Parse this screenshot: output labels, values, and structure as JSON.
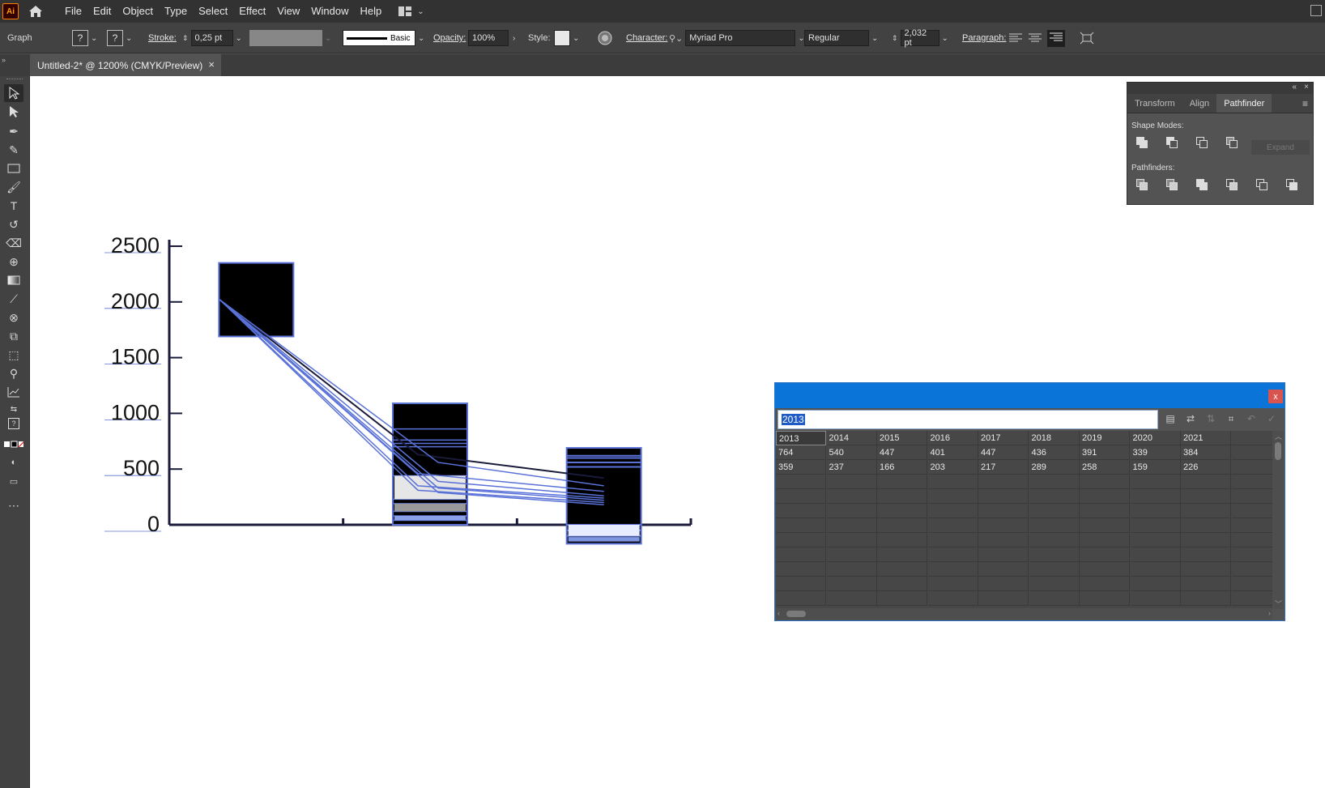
{
  "menubar": {
    "app_logo": "Ai",
    "items": [
      "File",
      "Edit",
      "Object",
      "Type",
      "Select",
      "Effect",
      "View",
      "Window",
      "Help"
    ]
  },
  "controlbar": {
    "selection_type": "Graph",
    "stroke_label": "Stroke:",
    "stroke_value": "0,25 pt",
    "brush_name": "Basic",
    "opacity_label": "Opacity:",
    "opacity_value": "100%",
    "style_label": "Style:",
    "character_label": "Character:",
    "font_family": "Myriad Pro",
    "font_style": "Regular",
    "font_size": "2,032 pt",
    "paragraph_label": "Paragraph:",
    "fill_icon": "?",
    "stroke_icon": "?"
  },
  "document_tab": {
    "title": "Untitled-2* @ 1200% (CMYK/Preview)",
    "close": "×"
  },
  "pathfinder": {
    "tabs": [
      "Transform",
      "Align",
      "Pathfinder"
    ],
    "active_tab": "Pathfinder",
    "shape_modes_label": "Shape Modes:",
    "pathfinders_label": "Pathfinders:",
    "expand_label": "Expand"
  },
  "graph_data": {
    "close_label": "x",
    "input_value": "2013",
    "rows": [
      [
        "2013",
        "2014",
        "2015",
        "2016",
        "2017",
        "2018",
        "2019",
        "2020",
        "2021"
      ],
      [
        "764",
        "540",
        "447",
        "401",
        "447",
        "436",
        "391",
        "339",
        "384"
      ],
      [
        "359",
        "237",
        "166",
        "203",
        "217",
        "289",
        "258",
        "159",
        "226"
      ]
    ]
  },
  "chart_data": {
    "type": "bar",
    "y_ticks": [
      "2500",
      "2000",
      "1500",
      "1000",
      "500",
      "0"
    ],
    "ylim": [
      0,
      2500
    ],
    "groups": [
      {
        "label": "",
        "top": 2350,
        "bottom": 1690
      },
      {
        "label": "",
        "top": 1090,
        "bottom": 0
      },
      {
        "label": "",
        "top": 690,
        "bottom": -170
      }
    ]
  },
  "colors": {
    "accent": "#0a74d9",
    "graph_blue": "#5a72d8",
    "graph_dark": "#000000"
  }
}
